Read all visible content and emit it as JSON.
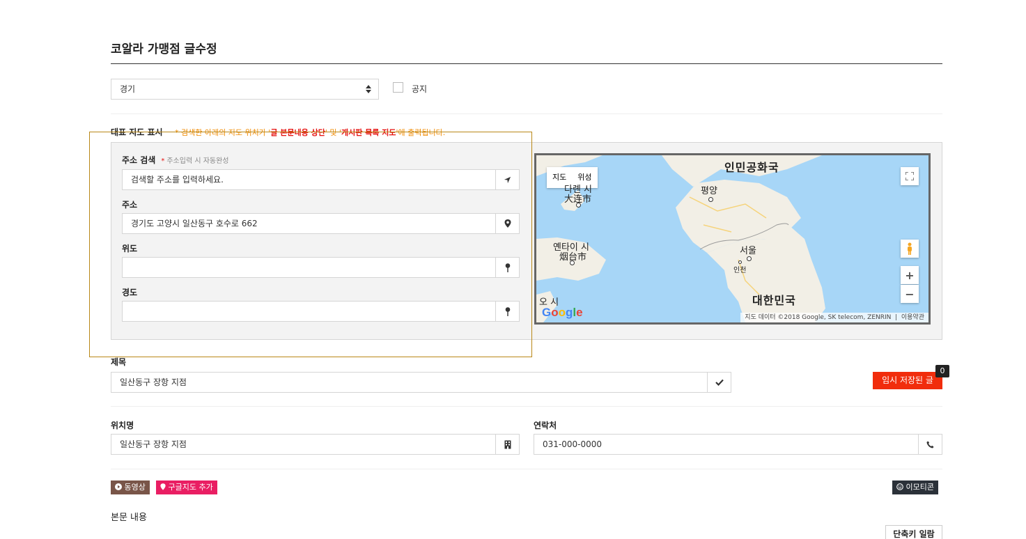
{
  "page": {
    "title": "코알라 가맹점 글수정"
  },
  "category": {
    "selected": "경기"
  },
  "notice": {
    "label": "공지"
  },
  "map_section": {
    "label": "대표 지도 표시",
    "hint_prefix": "* 검색한 아래의 지도 위치가 '",
    "hint_bold1": "글 본문내용 상단",
    "hint_mid": "' 및 '",
    "hint_bold2": "게시판 목록 지도",
    "hint_suffix": "'에 출력됩니다."
  },
  "address_search": {
    "label": "주소 검색",
    "sub_mark": "*",
    "sub": "주소입력 시 자동완성",
    "placeholder": "검색할 주소를 입력하세요."
  },
  "address": {
    "label": "주소",
    "value": "경기도 고양시 일산동구 호수로 662"
  },
  "latitude": {
    "label": "위도",
    "value": ""
  },
  "longitude": {
    "label": "경도",
    "value": ""
  },
  "map": {
    "tab_map": "지도",
    "tab_satellite": "위성",
    "labels": {
      "north_korea": "인민공화국",
      "pyongyang": "평양",
      "dalian_ko": "다롄 시",
      "dalian": "大连市",
      "yantai_ko": "옌타이 시",
      "yantai": "烟台市",
      "seoul": "서울",
      "incheon": "인천",
      "south_korea": "대한민국",
      "edge": "오 시"
    },
    "zoom_in": "+",
    "zoom_out": "−",
    "attribution": "지도 데이터 ©2018 Google, SK telecom, ZENRIN",
    "terms": "이용약관",
    "logo": "Google"
  },
  "subject": {
    "label": "제목",
    "value": "일산동구 장항 지점"
  },
  "temp_saved": {
    "label": "임시 저장된 글",
    "count": "0"
  },
  "location_name": {
    "label": "위치명",
    "value": "일산동구 장항 지점"
  },
  "contact": {
    "label": "연락처",
    "value": "031-000-0000"
  },
  "tags": {
    "video": "동영상",
    "gmap": "구글지도 추가",
    "emoticon": "이모티콘"
  },
  "body": {
    "label": "본문 내용"
  },
  "shortcut": {
    "label": "단축키 일람"
  },
  "colors": {
    "accent_red": "#f12d0c",
    "hint_orange": "#f08a00",
    "video_tag": "#795548",
    "gmap_tag": "#e91e63",
    "emoticon_tag": "#2b3139"
  }
}
